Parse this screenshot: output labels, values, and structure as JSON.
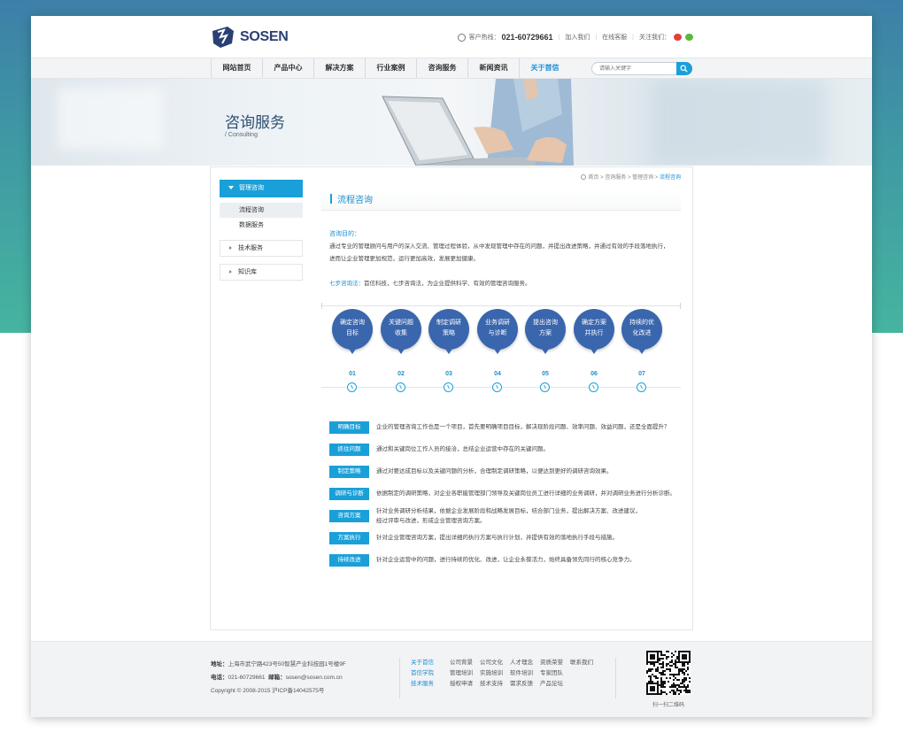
{
  "header": {
    "logo_text": "SOSEN",
    "hotline_label": "客户热线：",
    "hotline_number": "021-60729661",
    "join_label": "加入我们",
    "online_service_label": "在线客服",
    "follow_label": "关注我们："
  },
  "nav": {
    "items": [
      "网站首页",
      "产品中心",
      "解决方案",
      "行业案例",
      "咨询服务",
      "新闻资讯",
      "关于首信"
    ],
    "search_placeholder": "请输入关键字"
  },
  "banner": {
    "title": "咨询服务",
    "subtitle": "/ Consulting"
  },
  "sidebar": {
    "head": "管理咨询",
    "subs": [
      "流程咨询",
      "数据服务"
    ],
    "items": [
      "技术服务",
      "知识库"
    ]
  },
  "breadcrumb": {
    "items": [
      "首页",
      "咨询服务",
      "管理咨询"
    ],
    "current": "流程咨询",
    "sep": " > "
  },
  "main": {
    "section_title": "流程咨询",
    "purpose_heading": "咨询目的：",
    "purpose_line1": "通过专业的管理顾问与用户的深入交流、管理过程体验，从中发现管理中存在的问题，并提出改进策略，并通过有效的手段落地执行，",
    "purpose_line2": "进而让企业管理更加规范，运行更加高效，发展更加健康。",
    "method_label": "七步咨询法：",
    "method_text": "首信科技，七步咨询法，为企业提供科学、有效的管理咨询服务。"
  },
  "timeline": [
    {
      "l1": "确定咨询",
      "l2": "目标",
      "num": "01"
    },
    {
      "l1": "关键问题",
      "l2": "收集",
      "num": "02"
    },
    {
      "l1": "制定调研",
      "l2": "策略",
      "num": "03"
    },
    {
      "l1": "业务调研",
      "l2": "与诊断",
      "num": "04"
    },
    {
      "l1": "提出咨询",
      "l2": "方案",
      "num": "05"
    },
    {
      "l1": "确定方案",
      "l2": "并执行",
      "num": "06"
    },
    {
      "l1": "持续的优",
      "l2": "化改进",
      "num": "07"
    }
  ],
  "steps": [
    {
      "tag": "明确目标",
      "desc": "企业的管理咨询工作也是一个项目，首先要明确项目目标，解决现阶段问题、效率问题、效益问题，还是全面提升？"
    },
    {
      "tag": "抓住问题",
      "desc": "通过和关键岗位工作人员的接洽，总结企业运营中存在的关键问题。"
    },
    {
      "tag": "制定策略",
      "desc": "通过对要达成目标以及关键问题的分析，合理制定调研策略，以便达到更好的调研咨询效果。"
    },
    {
      "tag": "调研与诊断",
      "desc": "依据制定的调研策略，对企业各职能管理部门领导及关键岗位员工进行详细的业务调研，并对调研业务进行分析诊断。"
    },
    {
      "tag": "咨询方案",
      "desc": "针对业务调研分析结果，依据企业发展阶段和战略发展目标，结合部门业务，提出解决方案、改进建议，",
      "desc2": "经过评审与改进，形成企业管理咨询方案。"
    },
    {
      "tag": "方案执行",
      "desc": "针对企业管理咨询方案，提出详细的执行方案与执行计划，并提供有效的落地执行手段与措施。"
    },
    {
      "tag": "持续改进",
      "desc": "针对企业运营中的问题，进行持续的优化、改进，让企业永葆活力，始终具备领先同行的核心竞争力。"
    }
  ],
  "footer": {
    "address_label": "地址：",
    "address": "上海市武宁路423号50智慧产业科技园1号楼9F",
    "phone_label": "电话：",
    "phone": "021-60729661",
    "email_label": "邮箱：",
    "email": "sosen@sosen.com.cn",
    "copyright": "Copyright © 2008-2015 沪ICP备14042575号",
    "rows": [
      {
        "head": "关于首信",
        "links": [
          "公司背景",
          "公司文化",
          "人才理念",
          "资质荣誉",
          "联系我们"
        ]
      },
      {
        "head": "首信学院",
        "links": [
          "管理培训",
          "实施培训",
          "软件培训",
          "专家团队"
        ]
      },
      {
        "head": "技术服务",
        "links": [
          "授权申请",
          "技术支持",
          "需求反馈",
          "产品论坛"
        ]
      }
    ],
    "qr_caption": "扫一扫二维码"
  },
  "colors": {
    "accent": "#1aa0d9",
    "bubble": "#3a66ad",
    "bg_gradient_top": "#3d7fa8",
    "bg_gradient_bottom": "#46b4a0"
  }
}
